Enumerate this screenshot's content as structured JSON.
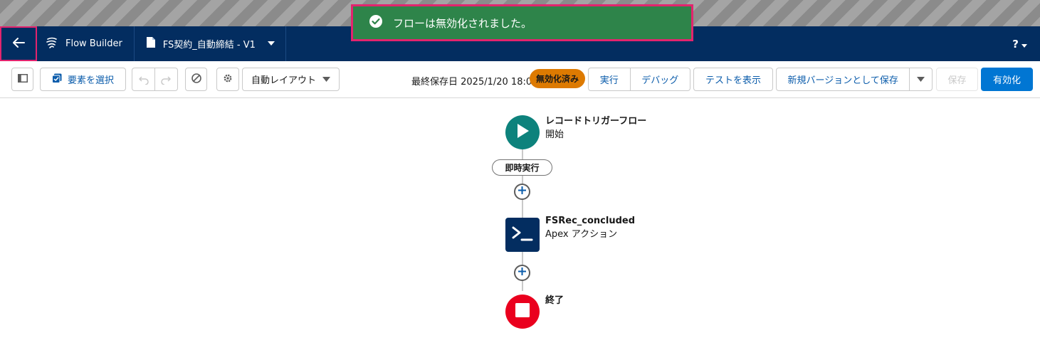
{
  "toast": {
    "message": "フローは無効化されました。",
    "color": "#2e844a"
  },
  "header": {
    "app_name": "Flow Builder",
    "flow_title": "FS契約_自動締結 - V1",
    "help_label": "?"
  },
  "toolbar": {
    "select_elements": "要素を選択",
    "layout_mode": "自動レイアウト",
    "last_saved": "最終保存日 2025/1/20 18:03",
    "status": "無効化済み",
    "run": "実行",
    "debug": "デバッグ",
    "view_tests": "テストを表示",
    "save_as_new_version": "新規バージョンとして保存",
    "save": "保存",
    "activate": "有効化"
  },
  "canvas": {
    "start": {
      "title": "レコードトリガーフロー",
      "subtitle": "開始"
    },
    "path_label": "即時実行",
    "action": {
      "title": "FSRec_concluded",
      "subtitle": "Apex アクション"
    },
    "end": {
      "title": "終了"
    }
  },
  "colors": {
    "header_bg": "#032d60",
    "brand_blue": "#0176d3",
    "badge_orange": "#dd7a01",
    "start_teal": "#0d827c",
    "action_navy": "#032d60",
    "end_red": "#ea001e",
    "highlight_pink": "#e3246e"
  }
}
